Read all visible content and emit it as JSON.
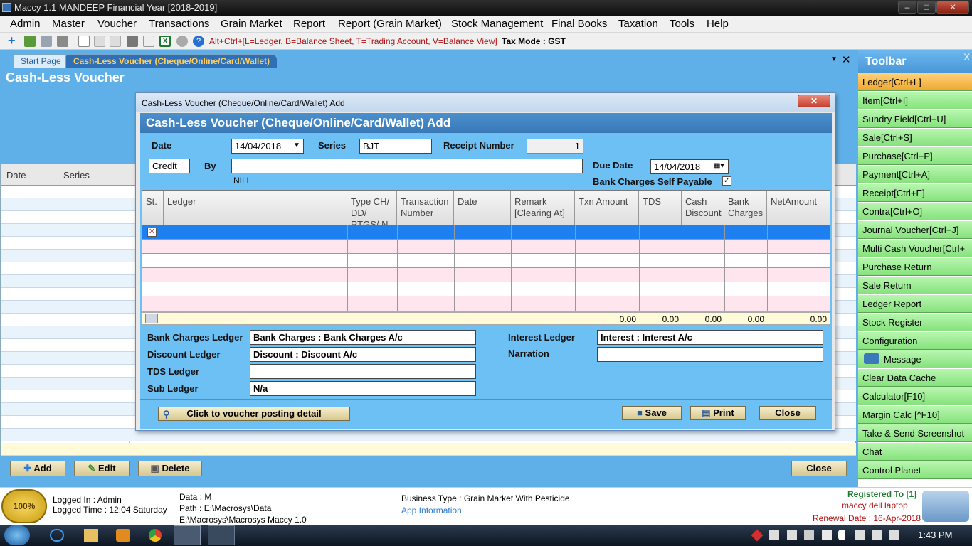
{
  "window": {
    "title": "Maccy 1.1 MANDEEP Financial Year [2018-2019]"
  },
  "menu": [
    "Admin",
    "Master",
    "Voucher",
    "Transactions",
    "Grain Market",
    "Report",
    "Report (Grain Market)",
    "Stock Management",
    "Final Books",
    "Taxation",
    "Tools",
    "Help"
  ],
  "toolbar": {
    "hint": "Alt+Ctrl+[L=Ledger, B=Balance Sheet, T=Trading Account, V=Balance View]",
    "tax_mode": "Tax Mode : GST"
  },
  "tabs": {
    "start": "Start Page",
    "active": "Cash-Less Voucher (Cheque/Online/Card/Wallet)"
  },
  "background": {
    "title": "Cash-Less Voucher",
    "columns": [
      "Date",
      "Series"
    ],
    "buttons": {
      "add": "Add",
      "edit": "Edit",
      "delete": "Delete",
      "close": "Close"
    }
  },
  "dialog": {
    "title": "Cash-Less Voucher (Cheque/Online/Card/Wallet) Add",
    "header": "Cash-Less Voucher (Cheque/Online/Card/Wallet) Add",
    "date_label": "Date",
    "date_value": "14/04/2018",
    "series_label": "Series",
    "series_value": "BJT",
    "receipt_label": "Receipt Number",
    "receipt_value": "1",
    "type_value": "Credit",
    "by_label": "By",
    "by_value": "",
    "by_sub": "NILL",
    "due_label": "Due Date",
    "due_value": "14/04/2018",
    "bank_self_label": "Bank Charges Self Payable",
    "columns": [
      "St.",
      "Ledger",
      "Type CH/ DD/ RTGS/ N",
      "Transaction Number",
      "Date",
      "Remark [Clearing At]",
      "Txn Amount",
      "TDS",
      "Cash Discount",
      "Bank Charges",
      "NetAmount"
    ],
    "totals": [
      "0.00",
      "0.00",
      "0.00",
      "0.00",
      "0.00"
    ],
    "bank_charges_label": "Bank Charges Ledger",
    "bank_charges_value": "Bank Charges : Bank Charges A/c",
    "discount_label": "Discount Ledger",
    "discount_value": "Discount : Discount A/c",
    "tds_label": "TDS Ledger",
    "tds_value": "",
    "sub_label": "Sub Ledger",
    "sub_value": "N/a",
    "interest_label": "Interest Ledger",
    "interest_value": "Interest : Interest A/c",
    "narration_label": "Narration",
    "narration_value": "",
    "posting_btn": "Click to voucher posting detail",
    "save_btn": "Save",
    "print_btn": "Print",
    "close_btn": "Close"
  },
  "right_toolbar": {
    "title": "Toolbar",
    "items": [
      "Ledger[Ctrl+L]",
      "Item[Ctrl+I]",
      "Sundry Field[Ctrl+U]",
      "Sale[Ctrl+S]",
      "Purchase[Ctrl+P]",
      "Payment[Ctrl+A]",
      "Receipt[Ctrl+E]",
      "Contra[Ctrl+O]",
      "Journal Voucher[Ctrl+J]",
      "Multi Cash Voucher[Ctrl+",
      "Purchase Return",
      "Sale Return",
      "Ledger Report",
      "Stock Register",
      "Configuration",
      "Message",
      "Clear Data Cache",
      "Calculator[F10]",
      "Margin Calc [^F10]",
      "Take & Send Screenshot",
      "Chat",
      "Control Planet"
    ]
  },
  "status": {
    "logged_in": "Logged In : Admin",
    "logged_time": "Logged Time : 12:04 Saturday",
    "data": "Data : M",
    "path": "Path : E:\\Macrosys\\Data",
    "path2": "E:\\Macrosys\\Macrosys Maccy 1.0",
    "business": "Business Type : Grain Market With Pesticide",
    "app_info": "App Information",
    "registered": "Registered To [1]",
    "machine": "maccy dell laptop",
    "renewal": "Renewal Date : 16-Apr-2018",
    "badge": "100%"
  },
  "taskbar": {
    "time": "1:43 PM"
  }
}
